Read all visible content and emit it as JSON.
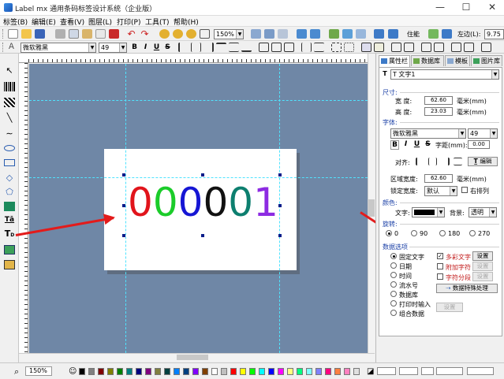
{
  "window": {
    "title": "Label mx 通用条码标签设计系统（企业版）",
    "minimize": "—",
    "maximize": "☐",
    "close": "✕"
  },
  "menu": [
    "标签(B)",
    "编辑(E)",
    "查看(V)",
    "图层(L)",
    "打印(P)",
    "工具(T)",
    "帮助(H)"
  ],
  "toolbar1": {
    "zoom_value": "150%",
    "bar_label": "住能",
    "left_margin_label": "左边(L):",
    "left_margin_value": "9.75"
  },
  "toolbar2": {
    "font_name": "微软雅黑",
    "font_size": "49",
    "bold": "B",
    "italic": "I",
    "underline": "U",
    "strike": "S"
  },
  "canvas": {
    "label_text": "000001",
    "digit_colors": [
      "#e1141b",
      "#1bcc2a",
      "#1616d4",
      "#111111",
      "#0d7f6f",
      "#8d2be2"
    ],
    "background": "#6f87a6"
  },
  "panel": {
    "tabs": [
      "属性栏",
      "数据库",
      "模板",
      "图片库"
    ],
    "object_select": "T 文字1",
    "size_section": "尺寸:",
    "width_label": "宽  度:",
    "width_value": "62.60",
    "height_label": "高  度:",
    "height_value": "23.03",
    "unit": "毫米(mm)",
    "font_section": "字体:",
    "font_name": "微软雅黑",
    "font_size": "49",
    "char_spacing_label": "字距(mm):",
    "char_spacing_value": "0.00",
    "align_label": "对齐:",
    "edit_button": "编辑",
    "area_width_label": "区域宽度:",
    "area_width_value": "62.60",
    "lock_width_label": "锁定宽度:",
    "lock_width_value": "默认",
    "right_align_label": "右排列",
    "color_section": "颜色:",
    "text_label": "文字:",
    "bg_label": "背景:",
    "bg_value": "透明",
    "rotate_section": "旋转:",
    "rotations": [
      "0",
      "90",
      "180",
      "270"
    ],
    "data_section": "数据选项",
    "data_sources": [
      "固定文字",
      "日期",
      "时间",
      "流水号",
      "数据库",
      "打印时输入",
      "组合数据"
    ],
    "multicolor_label": "多彩文字",
    "append_label": "附加字符",
    "split_label": "字符分段",
    "set_button": "设置",
    "special_button": "数据特殊处理"
  },
  "status": {
    "zoom": "150%"
  },
  "palette": [
    "#000000",
    "#808080",
    "#800000",
    "#808000",
    "#008000",
    "#008080",
    "#000080",
    "#800080",
    "#808040",
    "#004040",
    "#0080ff",
    "#004080",
    "#8000ff",
    "#804000",
    "#ffffff",
    "#c0c0c0",
    "#ff0000",
    "#ffff00",
    "#00ff00",
    "#00ffff",
    "#0000ff",
    "#ff00ff",
    "#ffff80",
    "#00ff80",
    "#80ffff",
    "#8080ff",
    "#ff0080",
    "#ff8040",
    "#ff80c0",
    "#e0e0e0"
  ]
}
